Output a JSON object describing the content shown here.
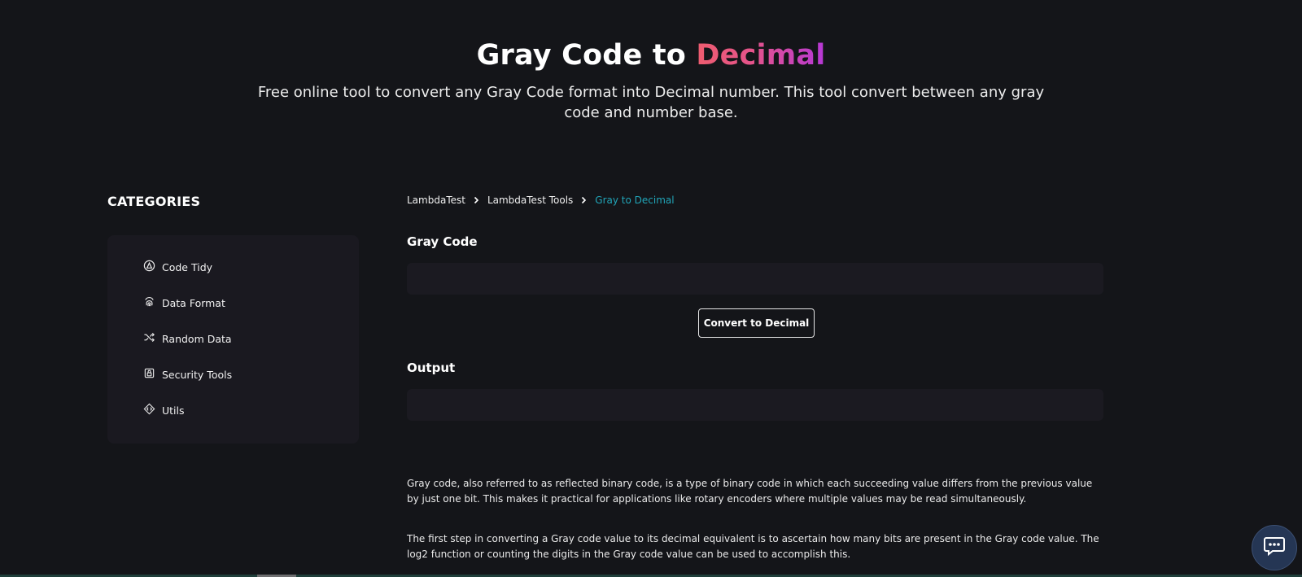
{
  "hero": {
    "title_prefix": "Gray Code to ",
    "title_accent": "Decimal",
    "subtitle": "Free online tool to convert any Gray Code format into Decimal number. This tool convert between any gray code and number base."
  },
  "sidebar": {
    "heading": "CATEGORIES",
    "items": [
      {
        "label": "Code Tidy",
        "icon": "code-tidy-icon"
      },
      {
        "label": "Data Format",
        "icon": "fingerprint-icon"
      },
      {
        "label": "Random Data",
        "icon": "shuffle-icon"
      },
      {
        "label": "Security Tools",
        "icon": "lock-icon"
      },
      {
        "label": "Utils",
        "icon": "diamond-code-icon"
      }
    ]
  },
  "breadcrumb": {
    "items": [
      "LambdaTest",
      "LambdaTest Tools",
      "Gray to Decimal"
    ]
  },
  "converter": {
    "input_label": "Gray Code",
    "input_value": "",
    "button_label": "Convert to Decimal",
    "output_label": "Output",
    "output_value": ""
  },
  "description": {
    "paragraphs": [
      "Gray code, also referred to as reflected binary code, is a type of binary code in which each succeeding value differs from the previous value by just one bit. This makes it practical for applications like rotary encoders where multiple values may be read simultaneously.",
      "The first step in converting a Gray code value to its decimal equivalent is to ascertain how many bits are present in the Gray code value. The log2 function or counting the digits in the Gray code value can be used to accomplish this."
    ]
  },
  "colors": {
    "background": "#141519",
    "panel": "#1a1920",
    "accent_gradient_start": "#ef5d6f",
    "accent_gradient_end": "#b638d6",
    "breadcrumb_current": "#21a5b8",
    "chat_button": "#253654"
  },
  "chat": {
    "icon": "chat-bubble-icon"
  }
}
